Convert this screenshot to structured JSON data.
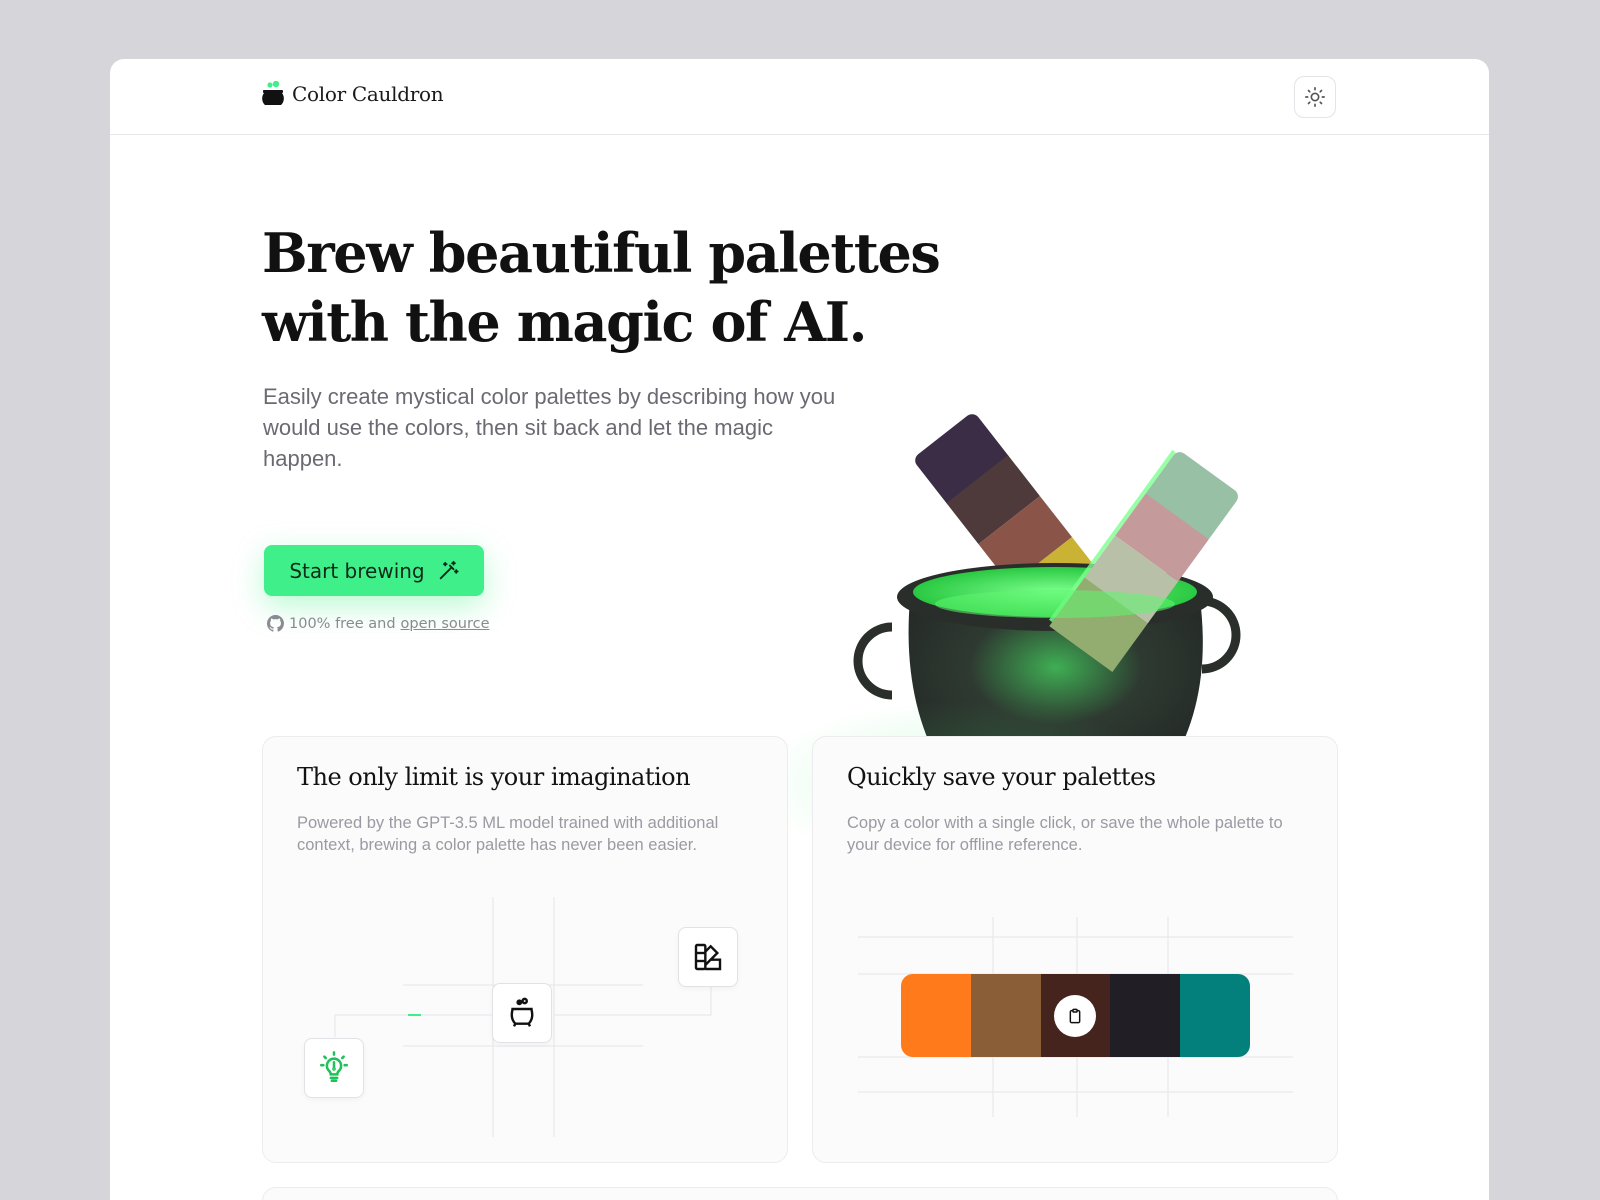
{
  "app": {
    "name": "Color Cauldron"
  },
  "header": {
    "theme_toggle_icon": "sun-icon"
  },
  "hero": {
    "title_line1": "Brew beautiful palettes",
    "title_line2": "with the magic of AI.",
    "subtitle": "Easily create mystical color palettes by describing how you would use the colors, then sit back and let the magic happen.",
    "cta_label": "Start brewing",
    "cta_icon": "magic-wand-icon",
    "note_prefix": "100% free and",
    "note_link": "open source"
  },
  "features": [
    {
      "title": "The only limit is your imagination",
      "description": "Powered by the GPT-3.5 ML model trained with additional context, brewing a color palette has never been easier."
    },
    {
      "title": "Quickly save your palettes",
      "description": "Copy a color with a single click, or save the whole palette to your device for offline reference."
    }
  ],
  "colors": {
    "accent": "#3ff08a",
    "palette": [
      "#ff7a1a",
      "#8a5e36",
      "#44241c",
      "#211f25",
      "#04807c"
    ],
    "hero_left_bar": [
      "#3b2d45",
      "#4e3a3a",
      "#8a5548",
      "#c9b234"
    ],
    "hero_right_bar": [
      "#98c0a4",
      "#c49a9b",
      "#b8c1a8",
      "#93ad70"
    ]
  }
}
